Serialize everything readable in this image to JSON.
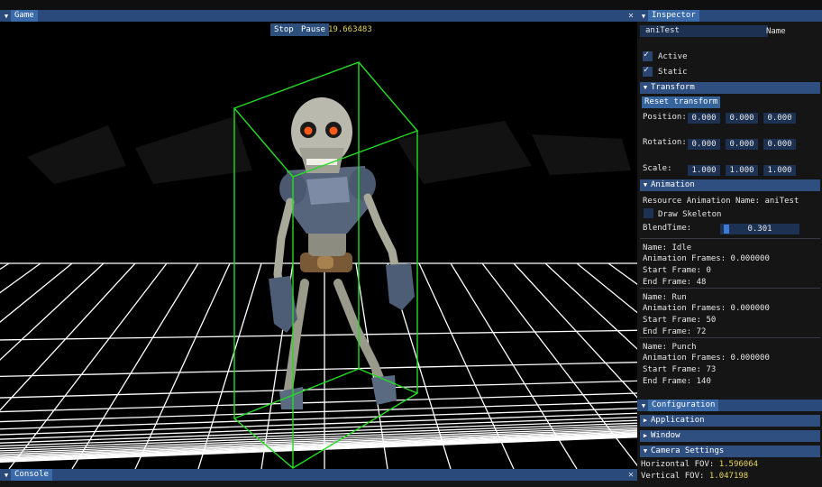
{
  "game": {
    "title": "Game",
    "close": "✕",
    "stop_label": "Stop",
    "pause_label": "Pause",
    "time": "19.663483"
  },
  "console": {
    "title": "Console",
    "close": "✕"
  },
  "inspector": {
    "title": "Inspector",
    "name_value": "aniTest",
    "name_label": "Name",
    "active_label": "Active",
    "active_checked": true,
    "static_label": "Static",
    "static_checked": true,
    "transform": {
      "header": "Transform",
      "reset_label": "Reset transform",
      "position_label": "Position:",
      "position": [
        "0.000",
        "0.000",
        "0.000"
      ],
      "rotation_label": "Rotation:",
      "rotation": [
        "0.000",
        "0.000",
        "0.000"
      ],
      "scale_label": "Scale:",
      "scale": [
        "1.000",
        "1.000",
        "1.000"
      ]
    },
    "animation": {
      "header": "Animation",
      "resource_name": "Resource Animation Name: aniTest",
      "draw_skeleton_label": "Draw Skeleton",
      "draw_skeleton_checked": false,
      "blendtime_label": "BlendTime:",
      "blendtime_value": "0.301",
      "blendtime_fraction": 0.03,
      "clips": [
        {
          "name": "Name: Idle",
          "frames": "Animation Frames: 0.000000",
          "start": "Start Frame: 0",
          "end": "End Frame: 48"
        },
        {
          "name": "Name: Run",
          "frames": "Animation Frames: 0.000000",
          "start": "Start Frame: 50",
          "end": "End Frame: 72"
        },
        {
          "name": "Name: Punch",
          "frames": "Animation Frames: 0.000000",
          "start": "Start Frame: 73",
          "end": "End Frame: 140"
        }
      ]
    }
  },
  "configuration": {
    "title": "Configuration",
    "application_header": "Application",
    "window_header": "Window",
    "camera_header": "Camera Settings",
    "hfov_label": "Horizontal FOV:",
    "hfov_value": "1.596064",
    "vfov_label": "Vertical FOV:",
    "vfov_value": "1.047198"
  },
  "colors": {
    "title_bar": "#294a7a",
    "header": "#2f4f80",
    "field": "#1d3152",
    "value_yellow": "#e6d35a",
    "bbox_green": "#22dd22"
  },
  "icons": [
    "collapse-triangle-icon",
    "close-icon",
    "checkmark-icon"
  ]
}
